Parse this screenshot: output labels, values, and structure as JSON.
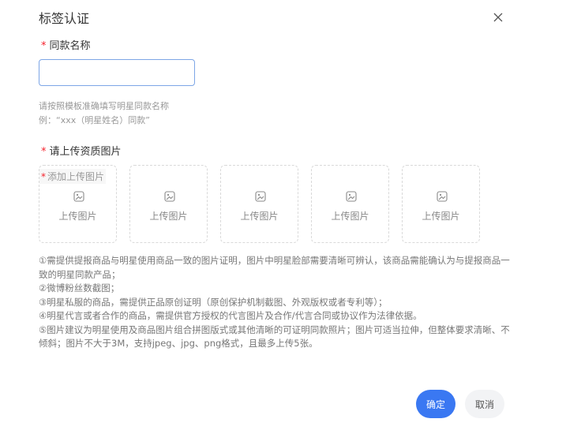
{
  "dialog": {
    "title": "标签认证",
    "close_icon": "close-icon"
  },
  "same_name": {
    "required_mark": "*",
    "label": "同款名称",
    "input_value": "",
    "input_placeholder": "",
    "hint_line1": "请按照模板准确填写明星同款名称",
    "hint_line2": "例：“xxx（明星姓名）同款”"
  },
  "upload": {
    "required_mark": "*",
    "label": "请上传资质图片",
    "first_tag_mark": "*",
    "first_tag": "添加上传图片",
    "box_icon": "image-icon",
    "boxes": [
      {
        "label": "上传图片"
      },
      {
        "label": "上传图片"
      },
      {
        "label": "上传图片"
      },
      {
        "label": "上传图片"
      },
      {
        "label": "上传图片"
      }
    ]
  },
  "rules": [
    "①需提供提报商品与明星使用商品一致的图片证明，图片中明星脸部需要清晰可辨认，该商品需能确认为与提报商品一致的明星同款产品；",
    "②微博粉丝数截图；",
    "③明星私服的商品，需提供正品原创证明（原创保护机制截图、外观版权或者专利等）；",
    "④明星代言或者合作的商品，需提供官方授权的代言图片及合作/代言合同或协议作为法律依据。",
    "⑤图片建议为明星使用及商品图片组合拼图版式或其他清晰的可证明同款照片；图片可适当拉伸，但整体要求清晰、不倾斜；图片不大于3M，支持jpeg、jpg、png格式，且最多上传5张。"
  ],
  "footer": {
    "confirm_label": "确定",
    "cancel_label": "取消",
    "confirm_color": "#3a78f2"
  }
}
